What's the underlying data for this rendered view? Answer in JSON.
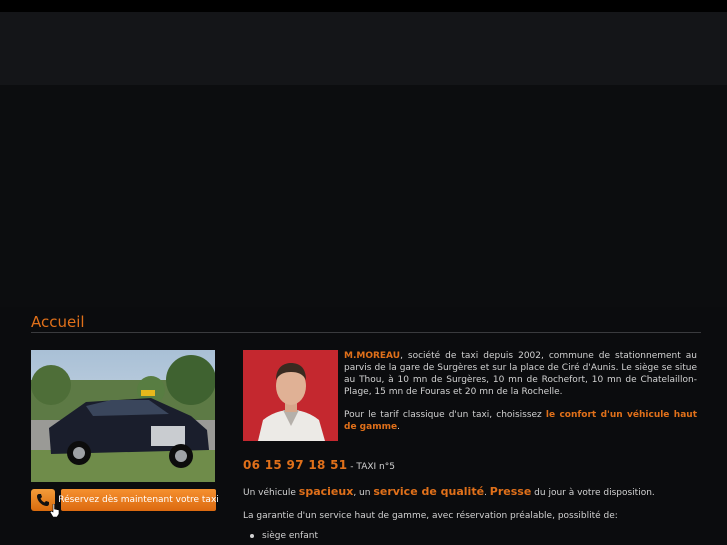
{
  "page": {
    "title": "Accueil"
  },
  "booking": {
    "button_label": "Réservez dès maintenant votre taxi",
    "icons": {
      "phone": "phone-icon",
      "cursor": "hand-cursor-icon"
    }
  },
  "intro": {
    "company_name": "M.MOREAU",
    "paragraph_1_rest": ", société de taxi depuis 2002, commune de stationnement au parvis de la gare de Surgères et sur la place de Ciré d'Aunis. Le siège se situe au Thou, à 10 mn de Surgères, 10 mn de Rochefort, 10 mn de Chatelaillon-Plage, 15 mn de Fouras et 20 mn de la Rochelle.",
    "paragraph_2_lead": "Pour le tarif classique d'un taxi, choisissez ",
    "paragraph_2_highlight": "le confort d'un véhicule haut de gamme",
    "paragraph_2_end": "."
  },
  "contact": {
    "phone_number": "06 15 97 18 51",
    "taxi_label": " - TAXI n°5"
  },
  "vehicle": {
    "part_1": "Un véhicule ",
    "highlight_1": "spacieux",
    "part_2": ", un ",
    "highlight_2": "service de qualité",
    "part_3": ". ",
    "highlight_3": "Presse",
    "part_4": " du jour à votre disposition."
  },
  "service": {
    "text": "La garantie d'un service haut de gamme, avec réservation préalable, possiblité de:",
    "options": [
      "siège enfant"
    ]
  },
  "colors": {
    "accent": "#e0701a",
    "background": "#0b0c0e",
    "text": "#d2d2d2"
  }
}
